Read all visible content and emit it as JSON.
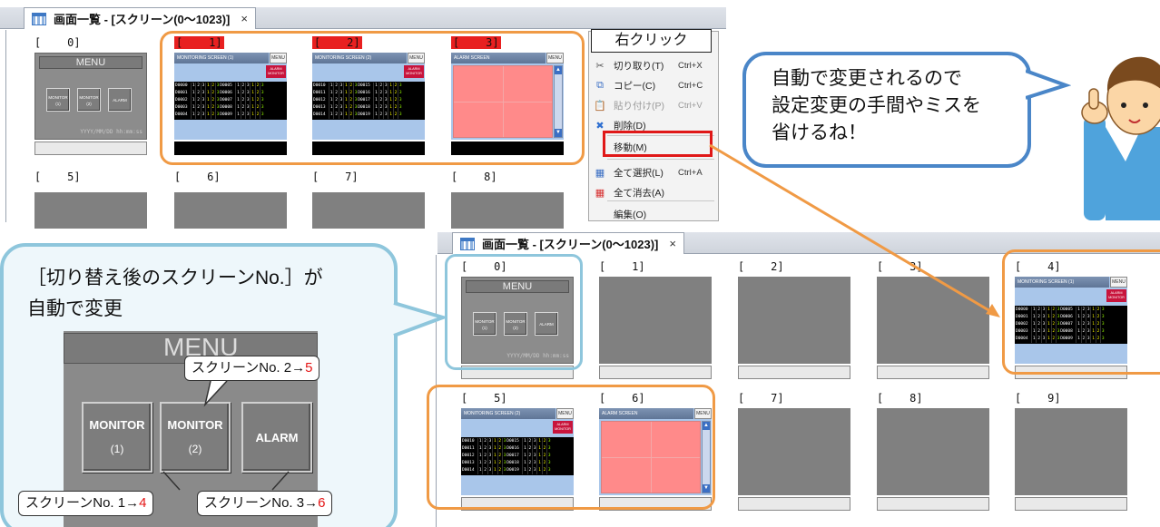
{
  "top_window": {
    "tab_title": "画面一覧 - [スクリーン(0〜1023)]",
    "tab_close": "×",
    "cells": [
      {
        "label": "[    0]",
        "kind": "menu",
        "selected": false
      },
      {
        "label": "[    1]",
        "kind": "monitor1",
        "selected": true
      },
      {
        "label": "[    2]",
        "kind": "monitor2",
        "selected": true
      },
      {
        "label": "[    3]",
        "kind": "alarm",
        "selected": true
      },
      {
        "label": "[    5]",
        "kind": "empty",
        "selected": false
      },
      {
        "label": "[    6]",
        "kind": "empty",
        "selected": false
      },
      {
        "label": "[    7]",
        "kind": "empty",
        "selected": false
      },
      {
        "label": "[    8]",
        "kind": "empty",
        "selected": false
      }
    ]
  },
  "bottom_window": {
    "tab_title": "画面一覧 - [スクリーン(0〜1023)]",
    "tab_close": "×",
    "cells": [
      {
        "label": "[    0]",
        "kind": "menu"
      },
      {
        "label": "[    1]",
        "kind": "empty"
      },
      {
        "label": "[    2]",
        "kind": "empty"
      },
      {
        "label": "[    3]",
        "kind": "empty"
      },
      {
        "label": "[    4]",
        "kind": "monitor1"
      },
      {
        "label": "[    5]",
        "kind": "monitor2"
      },
      {
        "label": "[    6]",
        "kind": "alarm"
      },
      {
        "label": "[    7]",
        "kind": "empty"
      },
      {
        "label": "[    8]",
        "kind": "empty"
      },
      {
        "label": "[    9]",
        "kind": "empty"
      }
    ]
  },
  "thumbnails": {
    "menu_title": "MENU",
    "menu_btn_monitor": "MONITOR",
    "menu_btn1_num": "(1)",
    "menu_btn2_num": "(2)",
    "menu_btn_alarm": "ALARM",
    "menu_date": "YYYY/MM/DD hh:mm:ss",
    "mon1_title": "MONITORING SCREEN (1)",
    "mon2_title": "MONITORING SCREEN (2)",
    "mon_menu": "MENU",
    "mon_alarm_l1": "ALARM",
    "mon_alarm_l2": "MONITOR",
    "alarm_title": "ALARM SCREEN",
    "alarm_menu": "MENU",
    "mon1_rows": [
      [
        "D0000",
        "D0005"
      ],
      [
        "D0001",
        "D0006"
      ],
      [
        "D0002",
        "D0007"
      ],
      [
        "D0003",
        "D0008"
      ],
      [
        "D0004",
        "D0009"
      ]
    ],
    "mon2_rows": [
      [
        "D0010",
        "D0015"
      ],
      [
        "D0011",
        "D0016"
      ],
      [
        "D0012",
        "D0017"
      ],
      [
        "D0013",
        "D0018"
      ],
      [
        "D0014",
        "D0019"
      ]
    ],
    "digits": [
      "1",
      "2",
      "3",
      "1",
      "2",
      "3"
    ]
  },
  "context_menu": {
    "header": "右クリック",
    "items": [
      {
        "label": "切り取り(T)",
        "shortcut": "Ctrl+X",
        "icon": "scissors-icon",
        "glyph": "✂",
        "color": "#555",
        "disabled": false
      },
      {
        "label": "コピー(C)",
        "shortcut": "Ctrl+C",
        "icon": "copy-icon",
        "glyph": "⧉",
        "color": "#3b6fc4",
        "disabled": false
      },
      {
        "label": "貼り付け(P)",
        "shortcut": "Ctrl+V",
        "icon": "paste-icon",
        "glyph": "📋",
        "color": "#b08a3a",
        "disabled": true
      },
      {
        "label": "削除(D)",
        "shortcut": "",
        "icon": "delete-icon",
        "glyph": "✖",
        "color": "#2e6fd0",
        "disabled": false
      },
      {
        "label": "移動(M)",
        "shortcut": "",
        "icon": "",
        "glyph": "",
        "color": "#333",
        "disabled": false
      },
      {
        "label": "全て選択(L)",
        "shortcut": "Ctrl+A",
        "icon": "select-all-icon",
        "glyph": "▦",
        "color": "#3b6fc4",
        "disabled": false
      },
      {
        "label": "全て消去(A)",
        "shortcut": "",
        "icon": "clear-all-icon",
        "glyph": "▦",
        "color": "#d63030",
        "disabled": false
      },
      {
        "label": "編集(O)",
        "shortcut": "",
        "icon": "",
        "glyph": "",
        "color": "#333",
        "disabled": false
      }
    ]
  },
  "bubble_text": "自動で変更されるので\n設定変更の手間やミスを\n省けるね！",
  "callout_text": "［切り替え後のスクリーンNo.］が\n自動で変更",
  "zoom": {
    "title": "MENU",
    "btn1_l1": "MONITOR",
    "btn1_l2": "(1)",
    "btn2_l1": "MONITOR",
    "btn2_l2": "(2)",
    "btn3": "ALARM"
  },
  "tags": {
    "tag2_prefix": "スクリーンNo. 2→",
    "tag2_new": "5",
    "tag1_prefix": "スクリーンNo. 1→",
    "tag1_new": "4",
    "tag3_prefix": "スクリーンNo. 3→",
    "tag3_new": "6"
  },
  "colors": {
    "accent_orange": "#f09a45",
    "accent_blue": "#4a86c8",
    "callout_blue": "#8ec6dc",
    "selection_red": "#e82020"
  }
}
